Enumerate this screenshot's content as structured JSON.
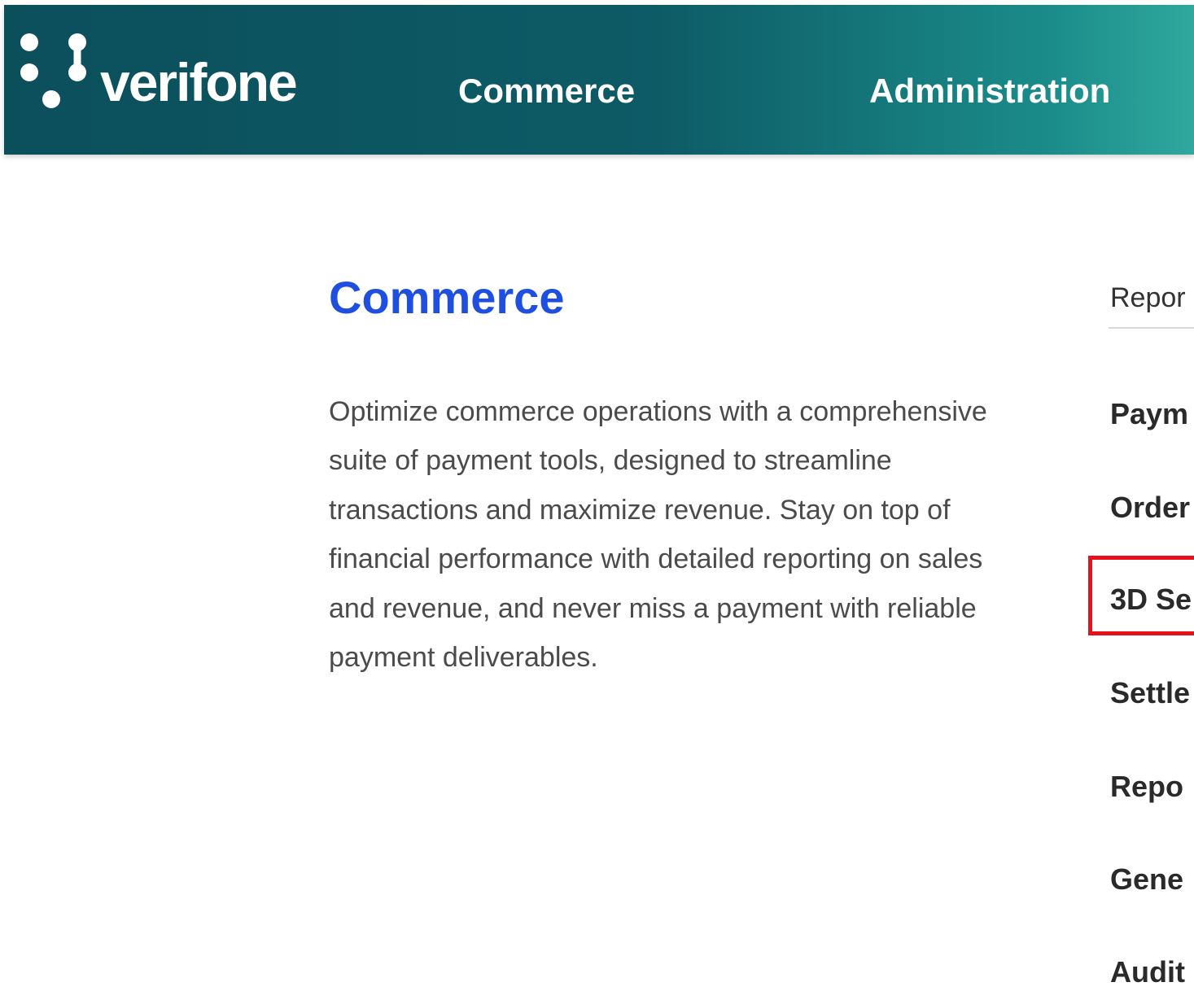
{
  "header": {
    "brand_name": "verifone",
    "nav": [
      {
        "label": "Commerce"
      },
      {
        "label": "Administration"
      }
    ]
  },
  "main": {
    "title": "Commerce",
    "description": "Optimize commerce operations with a comprehensive suite of payment tools, designed to streamline transactions and maximize revenue. Stay on top of financial performance with detailed reporting on sales and revenue, and never miss a payment with reliable payment deliverables."
  },
  "side_panel": {
    "header": "Repor",
    "items": [
      {
        "label": "Paym"
      },
      {
        "label": "Order"
      },
      {
        "label": "3D Se"
      },
      {
        "label": "Settle"
      },
      {
        "label": "Repo"
      },
      {
        "label": "Gene"
      },
      {
        "label": "Audit"
      }
    ]
  },
  "colors": {
    "header_start": "#0b4f5b",
    "header_end": "#2fa89d",
    "title_blue": "#1f4fe0",
    "highlight_red": "#e8111b"
  }
}
